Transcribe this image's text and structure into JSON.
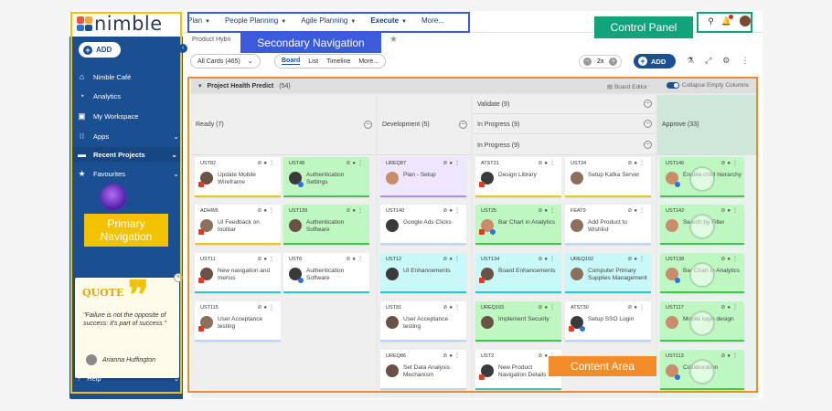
{
  "brand": {
    "name": "nimble",
    "colors": {
      "primary": "#1a4f92",
      "nav_bg": "#1a4f92",
      "annot_blue": "#3b5bdb",
      "annot_orange": "#f28c28",
      "annot_green": "#13a37a",
      "annot_yellow": "#f2c200",
      "card_green": "#bff7c2",
      "card_purple": "#efe6ff",
      "card_cyan": "#c8f8f8"
    }
  },
  "sidebar": {
    "add_label": "ADD",
    "items": [
      {
        "label": "Nimble Café",
        "icon": "home-icon"
      },
      {
        "label": "Analytics",
        "icon": "dashboard-icon"
      },
      {
        "label": "My Workspace",
        "icon": "workspace-icon"
      },
      {
        "label": "Apps",
        "icon": "apps-grid-icon"
      },
      {
        "label": "Recent Projects",
        "icon": "monitor-icon"
      },
      {
        "label": "Favourites",
        "icon": "star-icon"
      }
    ],
    "help_label": "Help"
  },
  "quote": {
    "title": "QUOTE",
    "text": "\"Failure is not the opposite of success: it's part of success.\"",
    "author": "Arianna Huffington"
  },
  "topnav": {
    "items": [
      {
        "label": "Plan"
      },
      {
        "label": "People Planning"
      },
      {
        "label": "Agile Planning"
      },
      {
        "label": "Execute"
      },
      {
        "label": "More..."
      }
    ]
  },
  "breadcrumb": "Product Hybri",
  "toolbar": {
    "filter": "All Cards (465)",
    "views": [
      "Board",
      "List",
      "Timeline",
      "More..."
    ],
    "zoom": "2x",
    "add_label": "ADD"
  },
  "swimlane": {
    "title": "Project Health Predict",
    "count": "(54)",
    "board_editor": "Board Editor",
    "collapse": "Collapse Empty Columns"
  },
  "columns": {
    "ready": "Ready (7)",
    "development": "Development (5)",
    "validate": "Validate (9)",
    "inprogress1": "In Progress (9)",
    "inprogress2": "In Progress (9)",
    "approve": "Approve (33)"
  },
  "cards": [
    {
      "id": "UST82",
      "title": "Update Mobile Wireframe"
    },
    {
      "id": "UST48",
      "title": "Authentication Settings"
    },
    {
      "id": "UREQ87",
      "title": "Plan - Setup"
    },
    {
      "id": "ATST31",
      "title": "Design Library"
    },
    {
      "id": "UST34",
      "title": "Setup Kafka Server"
    },
    {
      "id": "UST146",
      "title": "Enable child hierarchy"
    },
    {
      "id": "ADHW6",
      "title": "UI Feedback on toolbar"
    },
    {
      "id": "UST139",
      "title": "Authentication Software"
    },
    {
      "id": "UST140",
      "title": "Google Ads Clicks"
    },
    {
      "id": "UST25",
      "title": "Bar Chart in Analytics"
    },
    {
      "id": "FEAT9",
      "title": "Add Product to Wishlist"
    },
    {
      "id": "UST142",
      "title": "Search by Filter"
    },
    {
      "id": "UST11",
      "title": "New navigation and menus"
    },
    {
      "id": "UST8",
      "title": "Authentication Software"
    },
    {
      "id": "UST12",
      "title": "UI Enhancements"
    },
    {
      "id": "UST134",
      "title": "Board Enhancements"
    },
    {
      "id": "UREQ102",
      "title": "Computer Primary Supplies Management"
    },
    {
      "id": "UST138",
      "title": "Bar Chart in Analytics"
    },
    {
      "id": "UST115",
      "title": "User Acceptance testing"
    },
    {
      "id": "UST81",
      "title": "User Acceptance testing"
    },
    {
      "id": "UREQ103",
      "title": "Implement Security"
    },
    {
      "id": "ATST30",
      "title": "Setup SSO Login"
    },
    {
      "id": "UST117",
      "title": "Mobile login design"
    },
    {
      "id": "UREQ86",
      "title": "Set Data Analysis Mechanism"
    },
    {
      "id": "UST2",
      "title": "New Product Navigation Details"
    },
    {
      "id": "UST113",
      "title": "Collaboration"
    }
  ],
  "annotations": {
    "secondary": "Secondary Navigation",
    "control": "Control Panel",
    "primary": "Primary Navigation",
    "content": "Content Area"
  }
}
